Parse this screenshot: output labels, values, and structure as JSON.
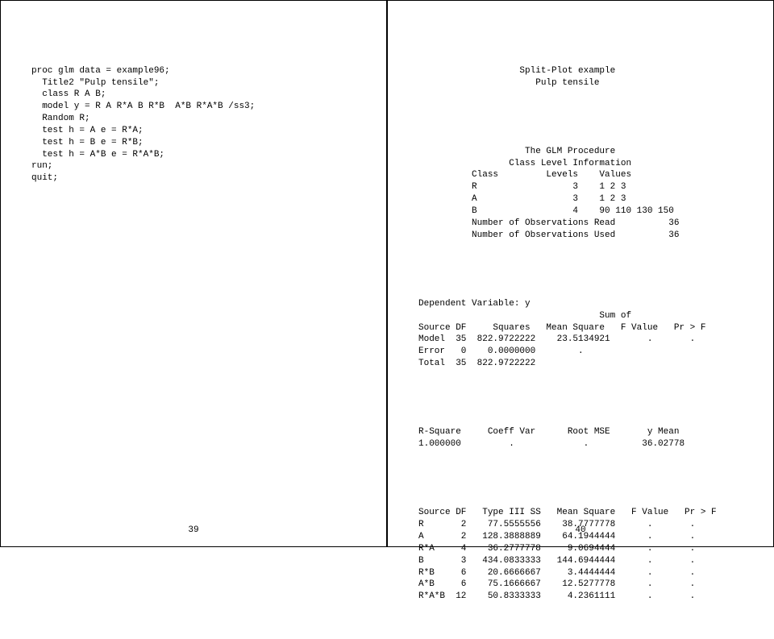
{
  "left": {
    "code": "proc glm data = example96;\n  Title2 \"Pulp tensile\";\n  class R A B;\n  model y = R A R*A B R*B  A*B R*A*B /ss3;\n  Random R;\n  test h = A e = R*A;\n  test h = B e = R*B;\n  test h = A*B e = R*A*B;\nrun;\nquit;",
    "pagenum": "39"
  },
  "right": {
    "title1": "                   Split-Plot example\n                      Pulp tensile",
    "proc": "                    The GLM Procedure\n                 Class Level Information\n          Class         Levels    Values\n          R                  3    1 2 3\n          A                  3    1 2 3\n          B                  4    90 110 130 150\n          Number of Observations Read          36\n          Number of Observations Used          36",
    "dep": "Dependent Variable: y\n                                  Sum of\nSource DF     Squares   Mean Square   F Value   Pr > F\nModel  35  822.9722222    23.5134921       .       .\nError   0    0.0000000        .\nTotal  35  822.9722222",
    "rsq": "R-Square     Coeff Var      Root MSE       y Mean\n1.000000         .             .          36.02778",
    "type3": "Source DF   Type III SS   Mean Square   F Value   Pr > F\nR       2    77.5555556    38.7777778      .       .\nA       2   128.3888889    64.1944444      .       .\nR*A     4    36.2777778     9.0694444      .       .\nB       3   434.0833333   144.6944444      .       .\nR*B     6    20.6666667     3.4444444      .       .\nA*B     6    75.1666667    12.5277778      .       .\nR*A*B  12    50.8333333     4.2361111      .       .",
    "pagenum": "40"
  },
  "chart_data": {
    "type": "table",
    "title": "Split-Plot example — Pulp tensile — The GLM Procedure",
    "class_level_information": [
      {
        "class": "R",
        "levels": 3,
        "values": "1 2 3"
      },
      {
        "class": "A",
        "levels": 3,
        "values": "1 2 3"
      },
      {
        "class": "B",
        "levels": 4,
        "values": "90 110 130 150"
      }
    ],
    "observations": {
      "read": 36,
      "used": 36
    },
    "anova_overall": {
      "columns": [
        "Source",
        "DF",
        "Sum of Squares",
        "Mean Square",
        "F Value",
        "Pr > F"
      ],
      "rows": [
        [
          "Model",
          35,
          822.9722222,
          23.5134921,
          null,
          null
        ],
        [
          "Error",
          0,
          0.0,
          null,
          null,
          null
        ],
        [
          "Total",
          35,
          822.9722222,
          null,
          null,
          null
        ]
      ]
    },
    "fit": {
      "R-Square": 1.0,
      "Coeff Var": null,
      "Root MSE": null,
      "y Mean": 36.02778
    },
    "type_iii_ss": {
      "columns": [
        "Source",
        "DF",
        "Type III SS",
        "Mean Square",
        "F Value",
        "Pr > F"
      ],
      "rows": [
        [
          "R",
          2,
          77.5555556,
          38.7777778,
          null,
          null
        ],
        [
          "A",
          2,
          128.3888889,
          64.1944444,
          null,
          null
        ],
        [
          "R*A",
          4,
          36.2777778,
          9.0694444,
          null,
          null
        ],
        [
          "B",
          3,
          434.0833333,
          144.6944444,
          null,
          null
        ],
        [
          "R*B",
          6,
          20.6666667,
          3.4444444,
          null,
          null
        ],
        [
          "A*B",
          6,
          75.1666667,
          12.5277778,
          null,
          null
        ],
        [
          "R*A*B",
          12,
          50.8333333,
          4.2361111,
          null,
          null
        ]
      ]
    }
  }
}
